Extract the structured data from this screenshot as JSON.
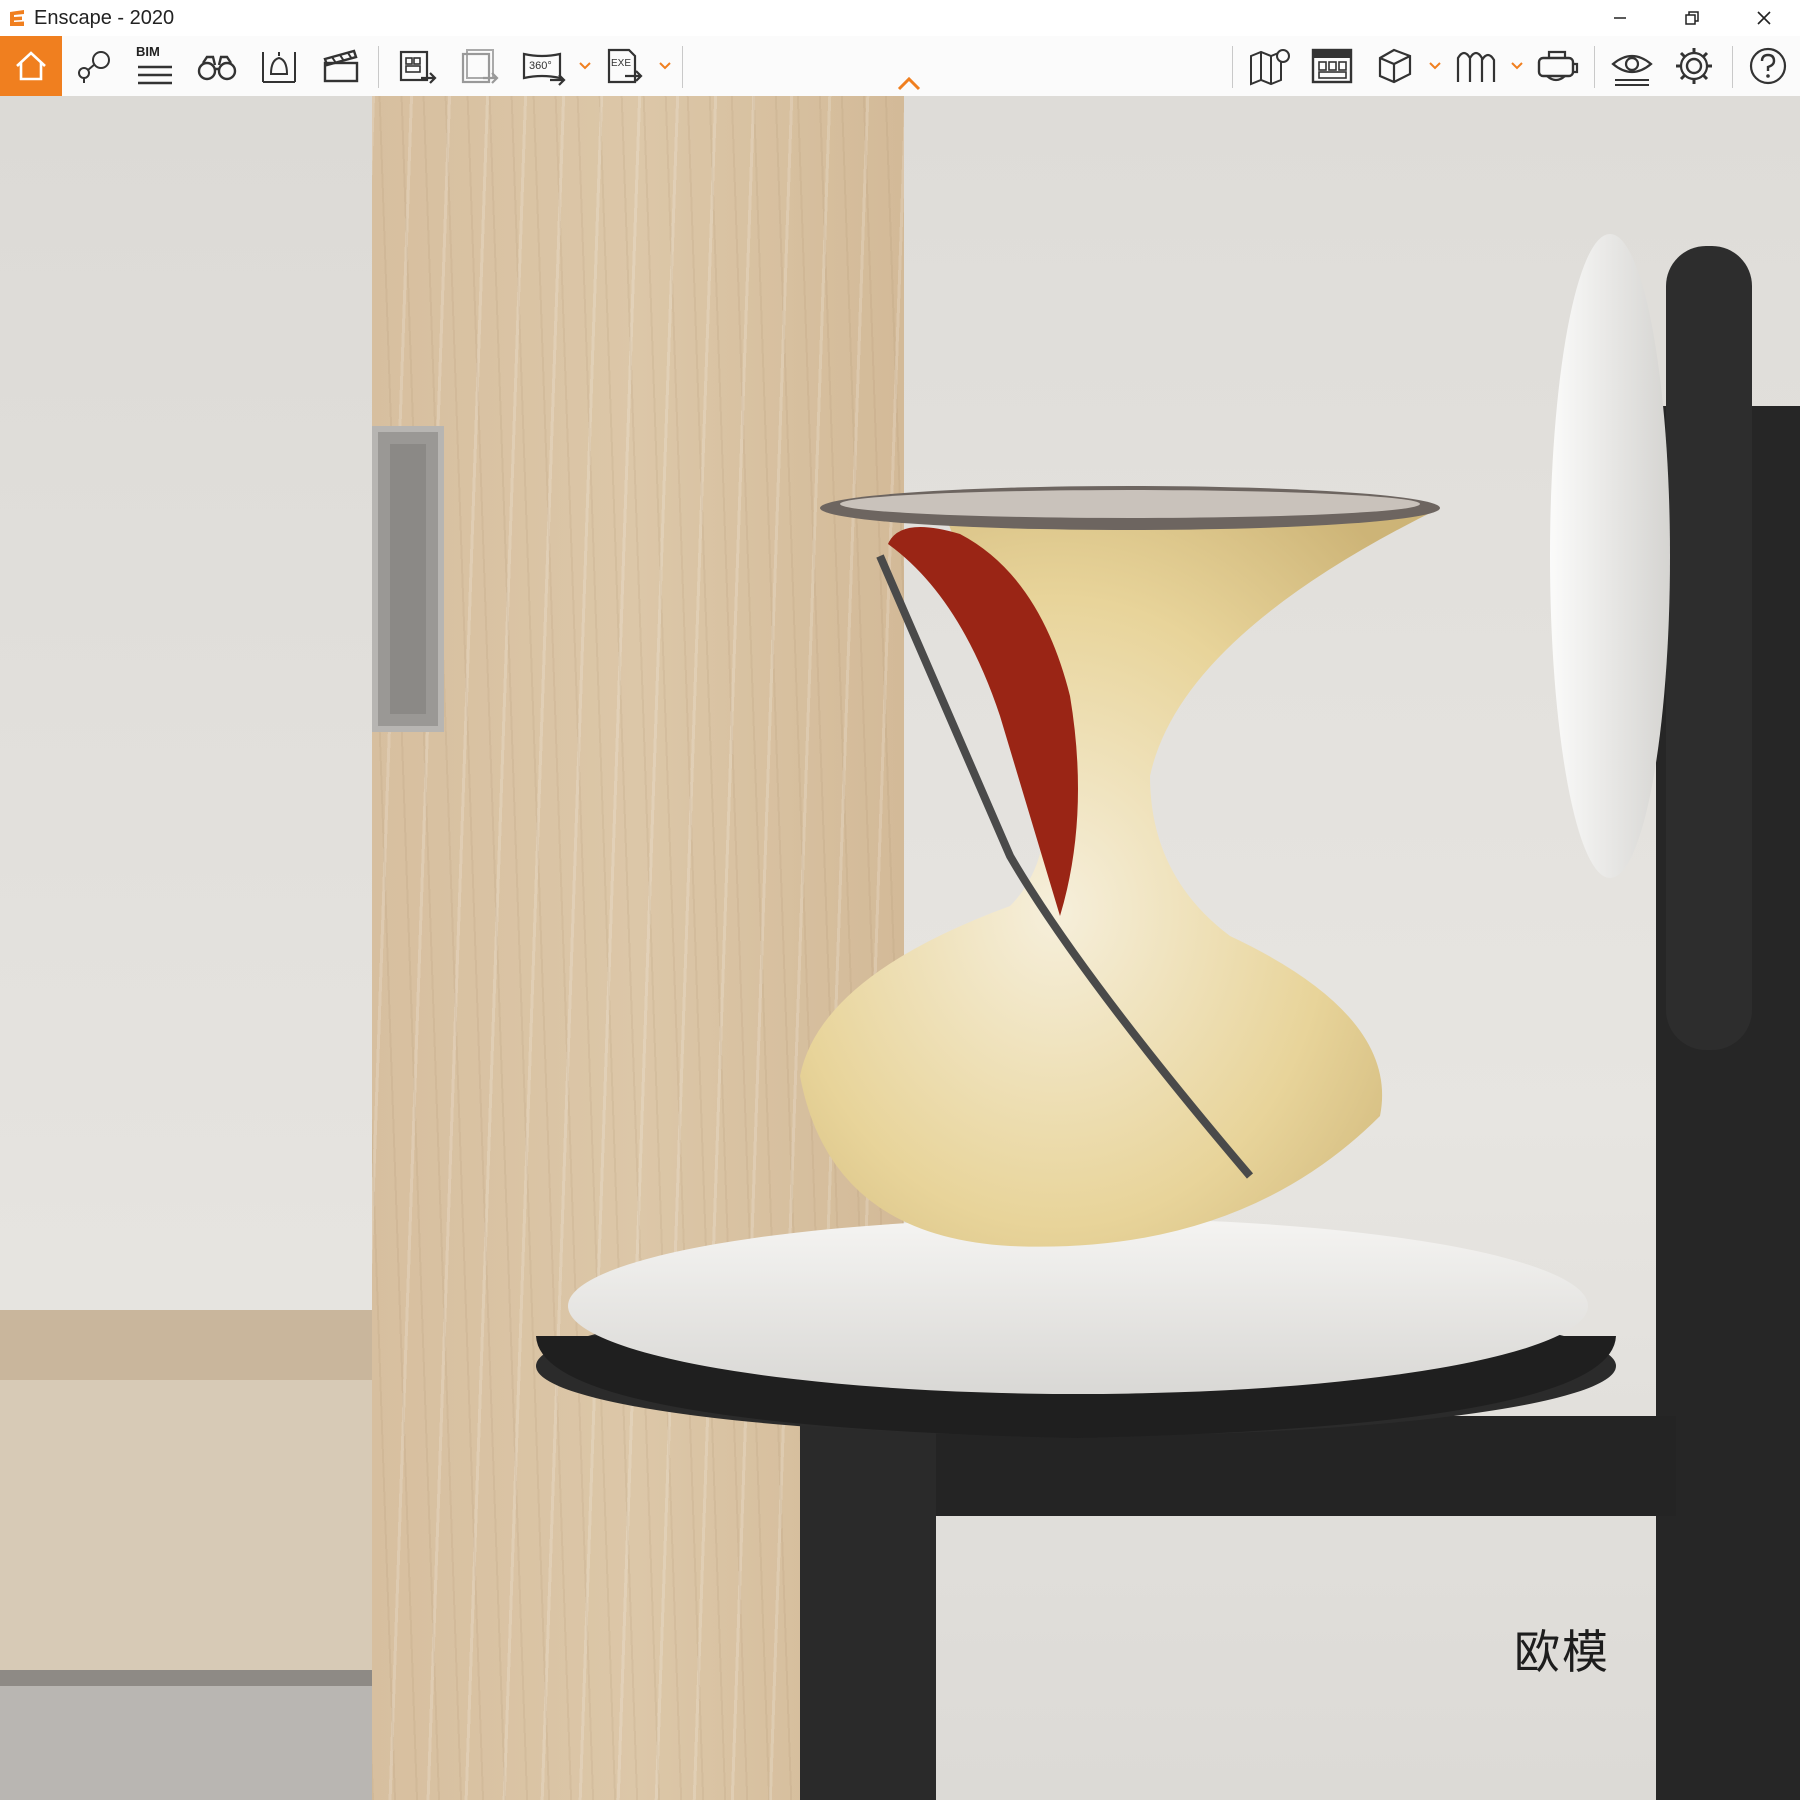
{
  "window": {
    "title": "Enscape - 2020"
  },
  "toolbar": {
    "bim_label": "BIM",
    "panorama_label": "360°",
    "exe_label": "EXE"
  },
  "scene": {
    "watermark_text": "欧模"
  },
  "colors": {
    "accent": "#f07f1f",
    "toolbar_bg": "#fbfbfb",
    "icon_stroke": "#333333"
  }
}
